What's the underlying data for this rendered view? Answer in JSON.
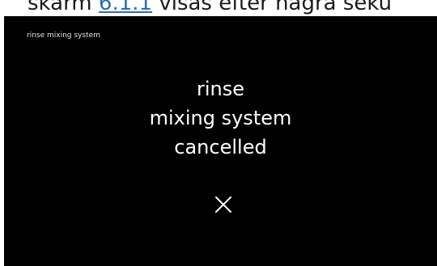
{
  "doc_caption": {
    "prefix": "skärm ",
    "link": "6.1.1",
    "suffix": " visas efter några seku"
  },
  "screen": {
    "header_title": "rinse mixing system",
    "message_lines": [
      "rinse",
      "mixing system",
      "cancelled"
    ],
    "status_icon": "close-x-icon"
  }
}
